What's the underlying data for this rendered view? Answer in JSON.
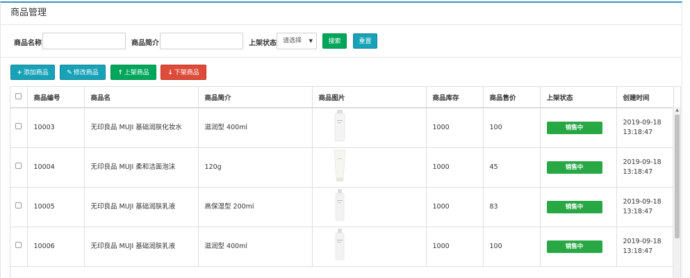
{
  "panel": {
    "title": "商品管理"
  },
  "search": {
    "name_label": "商品名称",
    "intro_label": "商品简介",
    "status_label": "上架状态",
    "status_value": "请选择",
    "search_btn": "搜索",
    "reset_btn": "重置"
  },
  "toolbar": {
    "add": "添加商品",
    "edit": "修改商品",
    "online": "上架商品",
    "offline": "下架商品"
  },
  "table": {
    "headers": [
      "商品编号",
      "商品名",
      "商品简介",
      "商品图片",
      "商品库存",
      "商品售价",
      "上架状态",
      "创建时间"
    ],
    "rows": [
      {
        "id": "10003",
        "name": "无印良品 MUJI 基础润肤化妆水",
        "intro": "滋润型 400ml",
        "image": "toner-bottle",
        "stock": "1000",
        "price": "100",
        "status": "销售中",
        "date": "2019-09-18",
        "time": "13:18:47"
      },
      {
        "id": "10004",
        "name": "无印良品 MUJI 柔和洁面泡沫",
        "intro": "120g",
        "image": "cleanser-tube",
        "stock": "1000",
        "price": "45",
        "status": "销售中",
        "date": "2019-09-18",
        "time": "13:18:47"
      },
      {
        "id": "10005",
        "name": "无印良品 MUJI 基础润肤乳液",
        "intro": "高保湿型 200ml",
        "image": "lotion-bottle",
        "stock": "1000",
        "price": "83",
        "status": "销售中",
        "date": "2019-09-18",
        "time": "13:18:47"
      },
      {
        "id": "10006",
        "name": "无印良品 MUJI 基础润肤乳液",
        "intro": "滋润型 400ml",
        "image": "lotion-bottle",
        "stock": "1000",
        "price": "100",
        "status": "销售中",
        "date": "2019-09-18",
        "time": "13:18:47"
      }
    ]
  },
  "colors": {
    "accent": "#3c8dbc",
    "teal": "#17a2b8",
    "green": "#00a65a",
    "red": "#dd4b39",
    "status_green": "#28a745"
  },
  "icons": {
    "add": "plus-icon",
    "edit": "edit-icon",
    "online": "arrow-up-icon",
    "offline": "arrow-down-icon"
  }
}
